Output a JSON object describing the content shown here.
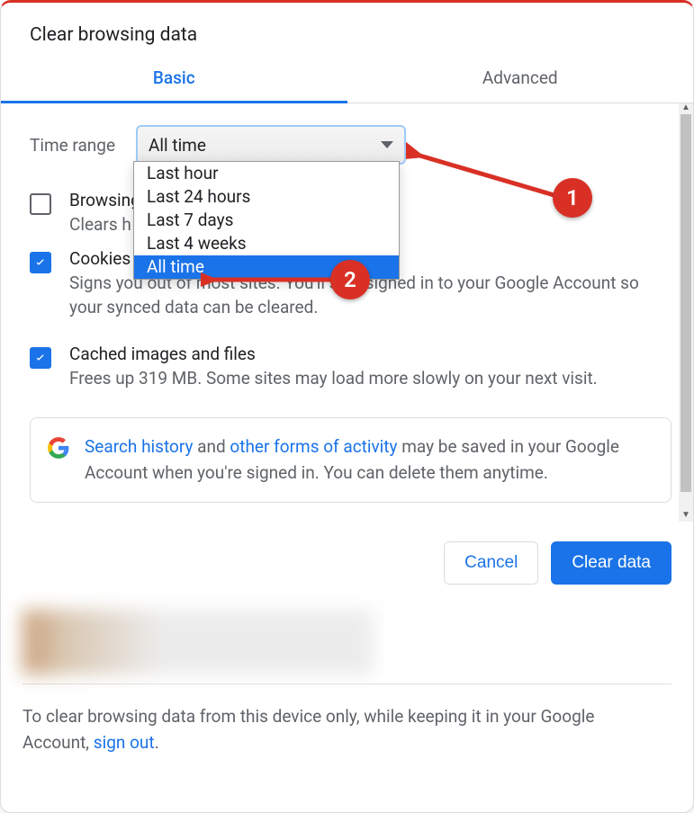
{
  "dialog": {
    "title": "Clear browsing data"
  },
  "tabs": {
    "basic": "Basic",
    "advanced": "Advanced"
  },
  "time_range": {
    "label": "Time range",
    "selected": "All time",
    "options": [
      "Last hour",
      "Last 24 hours",
      "Last 7 days",
      "Last 4 weeks",
      "All time"
    ]
  },
  "items": {
    "history": {
      "title": "Browsing history",
      "desc_prefix": "Clears h"
    },
    "cookies": {
      "title": "Cookies and other site data",
      "desc": "Signs you out of most sites. You'll stay signed in to your Google Account so your synced data can be cleared."
    },
    "cache": {
      "title": "Cached images and files",
      "desc": "Frees up 319 MB. Some sites may load more slowly on your next visit."
    }
  },
  "info": {
    "link1": "Search history",
    "mid1": " and ",
    "link2": "other forms of activity",
    "rest": " may be saved in your Google Account when you're signed in. You can delete them anytime."
  },
  "buttons": {
    "cancel": "Cancel",
    "clear": "Clear data"
  },
  "footer": {
    "text_pre": "To clear browsing data from this device only, while keeping it in your Google Account, ",
    "link": "sign out",
    "text_post": "."
  },
  "annotations": {
    "one": "1",
    "two": "2"
  },
  "colors": {
    "primary": "#1a73e8",
    "danger": "#d93025",
    "text_secondary": "#5f6368"
  }
}
